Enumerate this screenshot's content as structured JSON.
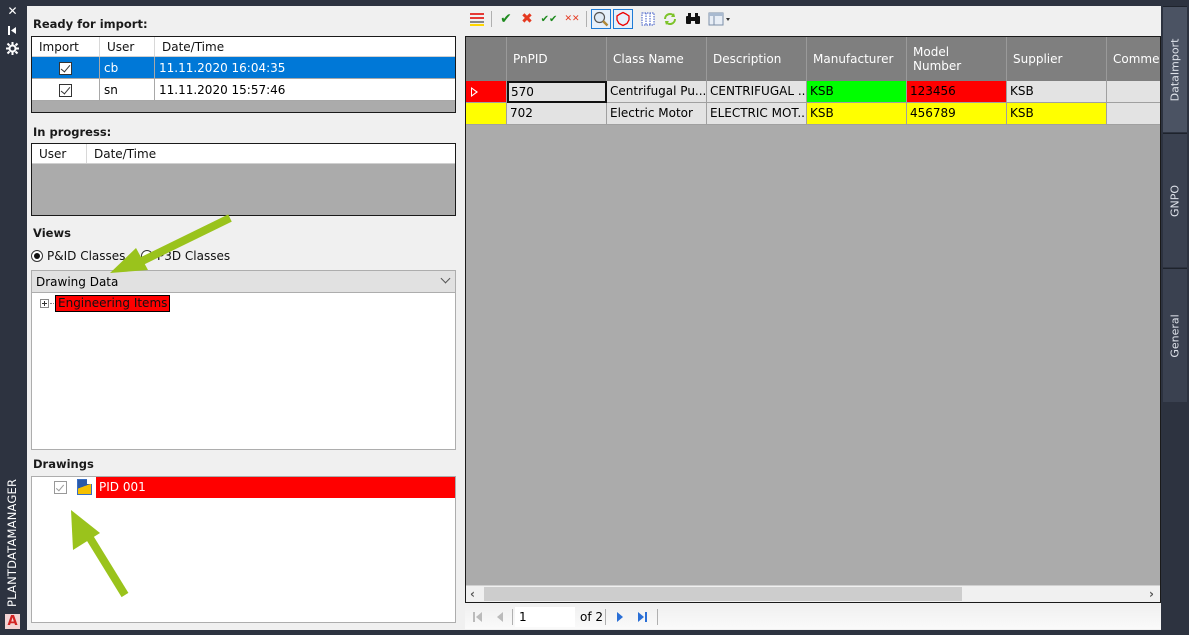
{
  "palette": {
    "chrome": "#2d3340",
    "selected_row": "#0078d7",
    "red_status": "#ff0000",
    "yellow_status": "#ffff00",
    "green_status": "#00ff00",
    "arrow": "#9ac31c"
  },
  "strip": {
    "icons": [
      "close-icon",
      "pin-icon",
      "settings-icon"
    ],
    "title": "PLANTDATAMANAGER",
    "logo": "A"
  },
  "ready_for_import": {
    "label": "Ready for import:",
    "columns": [
      "Import",
      "User",
      "Date/Time"
    ],
    "rows": [
      {
        "import": true,
        "user": "cb",
        "datetime": "11.11.2020 16:04:35",
        "selected": true
      },
      {
        "import": true,
        "user": "sn",
        "datetime": "11.11.2020 15:57:46",
        "selected": false
      }
    ]
  },
  "in_progress": {
    "label": "In progress:",
    "columns": [
      "User",
      "Date/Time"
    ],
    "rows": []
  },
  "views": {
    "label": "Views",
    "options": [
      {
        "label": "P&ID Classes",
        "selected": true
      },
      {
        "label": "P3D Classes",
        "selected": false
      }
    ],
    "dropdown_value": "Drawing Data",
    "tree": [
      {
        "label": "Engineering Items",
        "status": "red",
        "expandable": true
      }
    ]
  },
  "drawings": {
    "label": "Drawings",
    "items": [
      {
        "label": "PID 001",
        "checked": true,
        "status": "red"
      }
    ]
  },
  "toolbar": {
    "buttons": [
      {
        "name": "status-legend-icon",
        "active": false
      },
      {
        "name": "accept-icon",
        "active": false
      },
      {
        "name": "reject-icon",
        "active": false
      },
      {
        "name": "accept-all-icon",
        "active": false
      },
      {
        "name": "reject-all-icon",
        "active": false
      },
      {
        "name": "zoom-to-icon",
        "active": true
      },
      {
        "name": "highlight-icon",
        "active": true
      },
      {
        "name": "columns-icon",
        "active": false
      },
      {
        "name": "refresh-icon",
        "active": false
      },
      {
        "name": "find-icon",
        "active": false
      },
      {
        "name": "layout-dropdown-icon",
        "active": false
      }
    ]
  },
  "datagrid": {
    "columns": [
      "",
      "PnPID",
      "Class Name",
      "Description",
      "Manufacturer",
      "Model\nNumber",
      "Supplier",
      "Commen"
    ],
    "rows": [
      {
        "status": "red",
        "current": true,
        "cells": [
          "570",
          "Centrifugal Pu...",
          "CENTRIFUGAL ...",
          "KSB",
          "123456",
          "KSB",
          ""
        ],
        "cell_status": [
          "",
          "",
          "",
          "green",
          "red",
          "",
          ""
        ]
      },
      {
        "status": "yellow",
        "current": false,
        "cells": [
          "702",
          "Electric Motor",
          "ELECTRIC MOT...",
          "KSB",
          "456789",
          "KSB",
          ""
        ],
        "cell_status": [
          "",
          "",
          "",
          "yellow",
          "yellow",
          "yellow",
          ""
        ]
      }
    ]
  },
  "pager": {
    "current_page": "1",
    "of_label": "of 2"
  },
  "side_tabs": [
    {
      "label": "DataImport",
      "active": true
    },
    {
      "label": "GNPO",
      "active": false
    },
    {
      "label": "General",
      "active": false
    }
  ]
}
